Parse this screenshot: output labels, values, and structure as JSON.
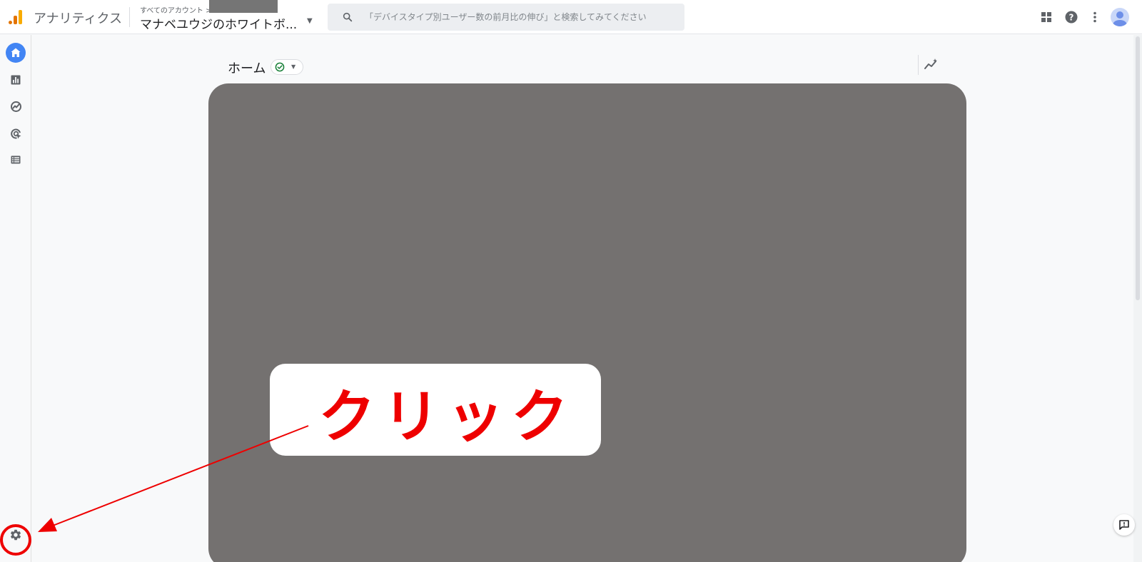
{
  "header": {
    "app_title": "アナリティクス",
    "account_crumb": "すべてのアカウント >",
    "property_name": "マナベユウジのホワイトボ...",
    "search_placeholder": "「デバイスタイプ別ユーザー数の前月比の伸び」と検索してみてください",
    "icons": [
      "apps-grid-icon",
      "help-icon",
      "more-vert-icon",
      "account-avatar-icon"
    ]
  },
  "nav": {
    "items": [
      {
        "name": "home",
        "icon": "home-icon",
        "active": true
      },
      {
        "name": "reports",
        "icon": "bar-chart-icon",
        "active": false
      },
      {
        "name": "explore",
        "icon": "explore-icon",
        "active": false
      },
      {
        "name": "advertising",
        "icon": "target-icon",
        "active": false
      },
      {
        "name": "configure",
        "icon": "list-icon",
        "active": false
      }
    ],
    "admin_icon": "gear-icon"
  },
  "main": {
    "title": "ホーム",
    "status_icon": "check-circle-icon",
    "insights_icon": "insights-icon"
  },
  "annotation": {
    "label": "クリック",
    "color": "#ee0000"
  },
  "colors": {
    "accent": "#4285f4",
    "overlay": "#747170",
    "logo_orange": "#e37400",
    "logo_yellow": "#f9ab00",
    "status_green": "#188038"
  }
}
